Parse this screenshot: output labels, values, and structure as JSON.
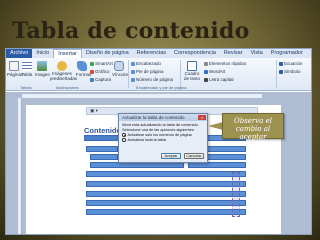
{
  "slide": {
    "title": "Tabla de contenido",
    "callout": "Observa el cambio al aceptar"
  },
  "app": {
    "tabs": [
      {
        "label": "Archivo"
      },
      {
        "label": "Inicio"
      },
      {
        "label": "Insertar"
      },
      {
        "label": "Diseño de página"
      },
      {
        "label": "Referencias"
      },
      {
        "label": "Correspondencia"
      },
      {
        "label": "Revisar"
      },
      {
        "label": "Vista"
      },
      {
        "label": "Programador"
      }
    ],
    "ribbon": {
      "paginas": "Páginas",
      "tabla": "Tabla",
      "imagen": "Imagen",
      "imagenes_predisenadas": "Imágenes prediseñadas",
      "formas": "Formas",
      "smartart": "SmartArt",
      "grafico": "Gráfico",
      "captura": "Captura",
      "vinculos": "Vínculos",
      "encabezado": "Encabezado",
      "pie_pagina": "Pie de página",
      "numero_pagina": "Número de página",
      "cuadro_texto": "Cuadro de texto",
      "elementos_rapidos": "Elementos rápidos",
      "wordart": "WordArt",
      "letra_capital": "Letra capital",
      "ecuacion": "Ecuación",
      "simbolo": "Símbolo",
      "grp_tablas": "Tablas",
      "grp_ilustraciones": "Ilustraciones",
      "grp_encabezado": "Encabezado y pie de página"
    },
    "document": {
      "heading": "Contenido"
    },
    "dialog": {
      "title": "Actualizar la tabla de contenido",
      "message": "Word está actualizando la tabla de contenido. Seleccione una de las opciones siguientes:",
      "option1": "Actualizar sólo los números de página",
      "option2": "Actualizar toda la tabla",
      "accept": "Aceptar",
      "cancel": "Cancelar",
      "close": "x"
    }
  },
  "colors": {
    "accent": "#2b5ca8",
    "toc_highlight": "#5b8fd6",
    "callout_bg": "#9e9250"
  }
}
